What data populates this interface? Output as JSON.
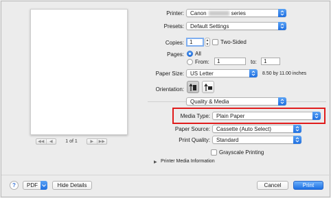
{
  "preview": {
    "page_label": "1 of 1",
    "first_prev": [
      "◀◀",
      "◀"
    ],
    "next_last": [
      "▶",
      "▶▶"
    ]
  },
  "printer": {
    "label": "Printer:",
    "value_prefix": "Canon",
    "value_suffix": "series"
  },
  "presets": {
    "label": "Presets:",
    "value": "Default Settings"
  },
  "copies": {
    "label": "Copies:",
    "value": "1",
    "two_sided_label": "Two-Sided"
  },
  "pages": {
    "label": "Pages:",
    "all_label": "All",
    "from_label": "From:",
    "from_value": "1",
    "to_label": "to:",
    "to_value": "1",
    "selected": "All"
  },
  "paper_size": {
    "label": "Paper Size:",
    "value": "US Letter",
    "dimensions": "8.50 by 11.00 inches"
  },
  "orientation": {
    "label": "Orientation:",
    "selected": "portrait"
  },
  "section": {
    "value": "Quality & Media"
  },
  "media_type": {
    "label": "Media Type:",
    "value": "Plain Paper"
  },
  "paper_source": {
    "label": "Paper Source:",
    "value": "Cassette (Auto Select)"
  },
  "print_quality": {
    "label": "Print Quality:",
    "value": "Standard"
  },
  "grayscale": {
    "label": "Grayscale Printing",
    "checked": false
  },
  "printer_media_info": {
    "label": "Printer Media Information"
  },
  "footer": {
    "help": "?",
    "pdf_label": "PDF",
    "hide_details_label": "Hide Details",
    "cancel_label": "Cancel",
    "print_label": "Print"
  },
  "colors": {
    "accent": "#1f6fe0",
    "highlight_border": "#e01b1b"
  }
}
